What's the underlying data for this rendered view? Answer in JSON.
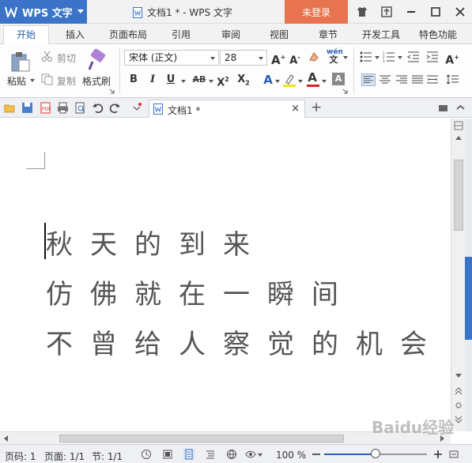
{
  "titlebar": {
    "app_name": "WPS 文字",
    "doc_title": "文档1 * - WPS 文字",
    "login_label": "未登录"
  },
  "ribbon_tabs": [
    "开始",
    "插入",
    "页面布局",
    "引用",
    "审阅",
    "视图",
    "章节",
    "开发工具",
    "特色功能"
  ],
  "clipboard": {
    "paste": "粘贴",
    "cut": "剪切",
    "copy": "复制",
    "format_painter": "格式刷"
  },
  "font": {
    "family": "宋体 (正文)",
    "size": "28"
  },
  "doc_tab": {
    "label": "文档1 *",
    "close": "×",
    "new": "+"
  },
  "document": {
    "lines": [
      "秋天的到来",
      "仿佛就在一瞬间",
      "不曾给人察觉的机会"
    ]
  },
  "statusbar": {
    "page_num": "页码: 1",
    "page": "页面: 1/1",
    "section": "节: 1/1",
    "zoom": "100 %",
    "zoom_value": 0.5
  },
  "watermark": "Baidu经验",
  "colors": {
    "brand_blue": "#3a73c7",
    "login_orange": "#e8734f",
    "active_tab_text": "#2a62b5"
  }
}
